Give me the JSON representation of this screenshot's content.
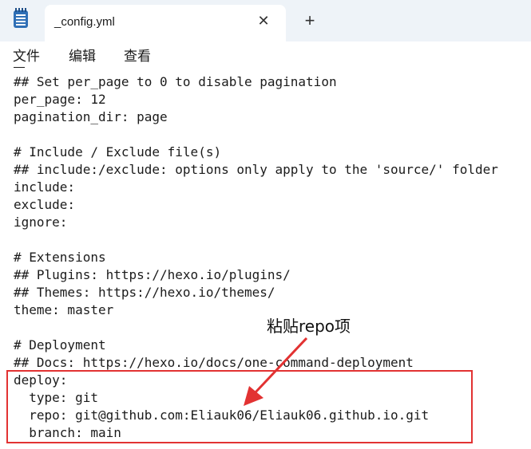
{
  "window": {
    "tab_title": "_config.yml",
    "close_glyph": "✕",
    "new_tab_glyph": "+"
  },
  "menu": {
    "items": [
      "文件",
      "编辑",
      "查看"
    ]
  },
  "editor": {
    "lines": [
      "## Set per_page to 0 to disable pagination",
      "per_page: 12",
      "pagination_dir: page",
      "",
      "# Include / Exclude file(s)",
      "## include:/exclude: options only apply to the 'source/' folder",
      "include:",
      "exclude:",
      "ignore:",
      "",
      "# Extensions",
      "## Plugins: https://hexo.io/plugins/",
      "## Themes: https://hexo.io/themes/",
      "theme: master",
      "",
      "# Deployment",
      "## Docs: https://hexo.io/docs/one-command-deployment",
      "deploy:",
      "  type: git",
      "  repo: git@github.com:Eliauk06/Eliauk06.github.io.git",
      "  branch: main"
    ]
  },
  "annotation": {
    "label": "粘贴repo项",
    "color": "#e23232"
  },
  "icons": {
    "app": "notepad-icon",
    "close": "close-icon",
    "add": "plus-icon"
  }
}
